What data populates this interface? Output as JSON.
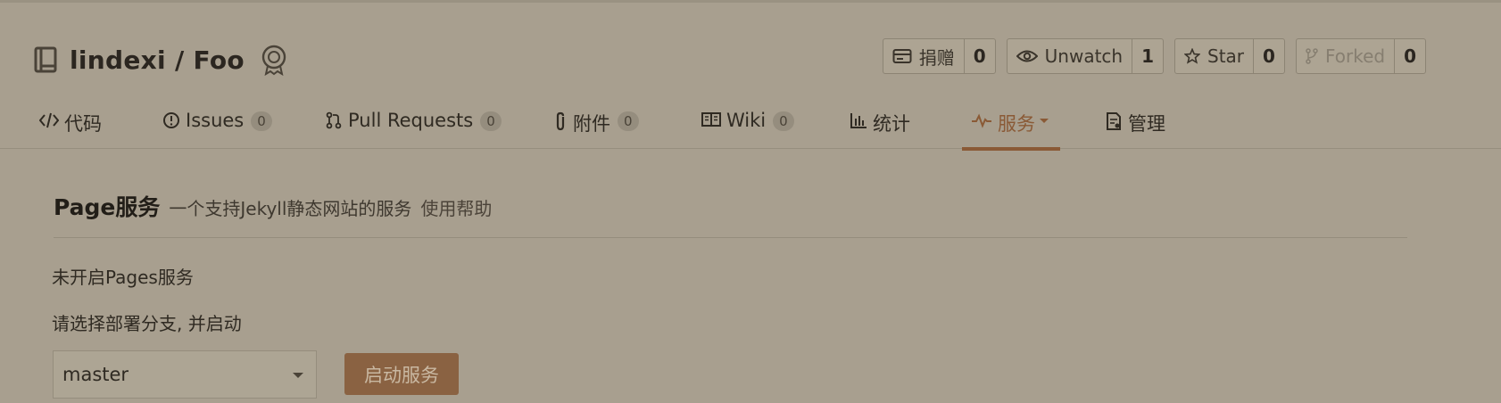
{
  "repo": {
    "title": "lindexi / Foo"
  },
  "actions": [
    {
      "label": "捐赠",
      "count": "0",
      "icon": "donate-icon"
    },
    {
      "label": "Unwatch",
      "count": "1",
      "icon": "eye-icon"
    },
    {
      "label": "Star",
      "count": "0",
      "icon": "star-icon"
    },
    {
      "label": "Forked",
      "count": "0",
      "icon": "fork-icon",
      "disabled": true
    }
  ],
  "tabs": [
    {
      "label": "代码",
      "icon": "code-icon"
    },
    {
      "label": "Issues",
      "count": "0",
      "icon": "issue-icon"
    },
    {
      "label": "Pull Requests",
      "count": "0",
      "icon": "pull-request-icon"
    },
    {
      "label": "附件",
      "count": "0",
      "icon": "paperclip-icon"
    },
    {
      "label": "Wiki",
      "count": "0",
      "icon": "book-icon"
    },
    {
      "label": "统计",
      "icon": "bar-chart-icon"
    },
    {
      "label": "服务",
      "icon": "pulse-icon",
      "active": true
    },
    {
      "label": "管理",
      "icon": "settings-doc-icon"
    }
  ],
  "page": {
    "title": "Page服务",
    "description": "一个支持Jekyll静态网站的服务",
    "help_link": "使用帮助",
    "status": "未开启Pages服务",
    "prompt": "请选择部署分支, 并启动",
    "branch_value": "master",
    "start_button": "启动服务"
  },
  "colors": {
    "background": "#a89f8f",
    "accent": "#8a5a36",
    "button": "#8a6242"
  }
}
